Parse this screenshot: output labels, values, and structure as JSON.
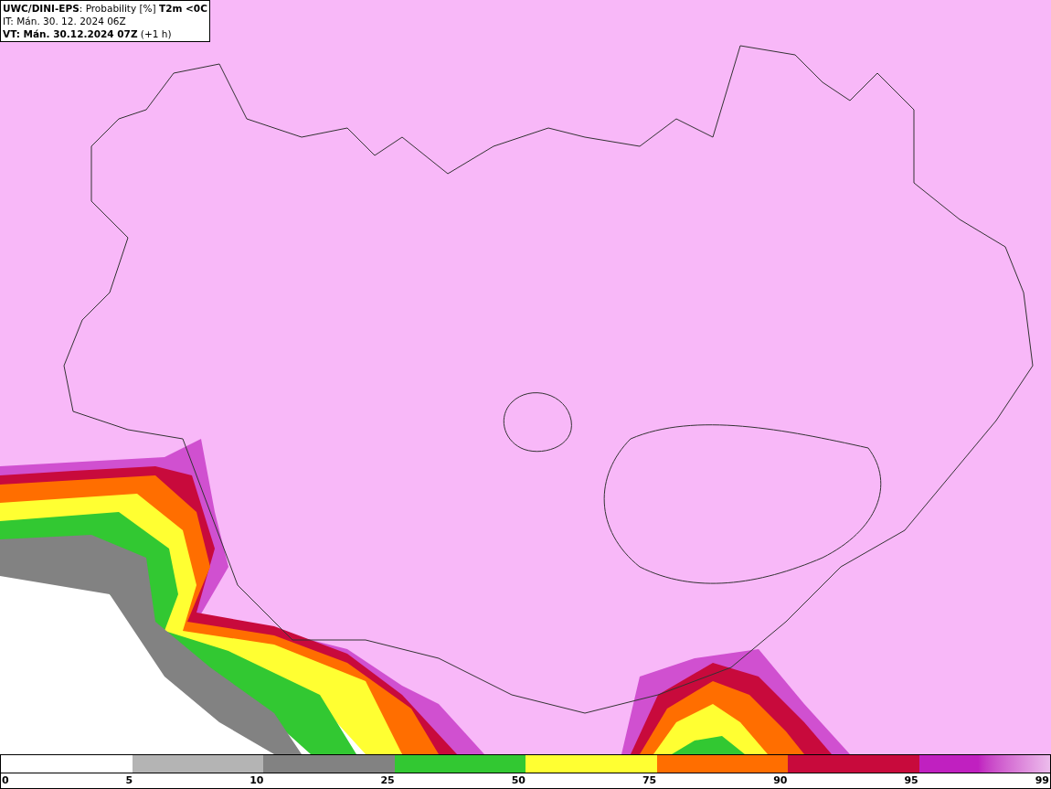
{
  "header": {
    "title": "**UWC/DINI-EPS**: Probability [%] **T2m <0C**",
    "initial_time": "IT: Mán. 30. 12. 2024 06Z",
    "valid_time": "**VT: Mán. 30.12.2024 07Z** (+1 h)"
  },
  "legend": {
    "bins": [
      {
        "kind": "blank"
      },
      {
        "kind": "solid",
        "color": "#b4b4b4"
      },
      {
        "kind": "solid",
        "color": "#828282"
      },
      {
        "kind": "solid",
        "color": "#32c832"
      },
      {
        "kind": "solid",
        "color": "#ffff32"
      },
      {
        "kind": "solid",
        "color": "#ff6e00"
      },
      {
        "kind": "solid",
        "color": "#c80a3c"
      },
      {
        "kind": "gradient",
        "color": "#c020c0"
      }
    ],
    "labels": [
      "0",
      "5",
      "10",
      "25",
      "50",
      "75",
      "90",
      "95",
      "99"
    ]
  }
}
